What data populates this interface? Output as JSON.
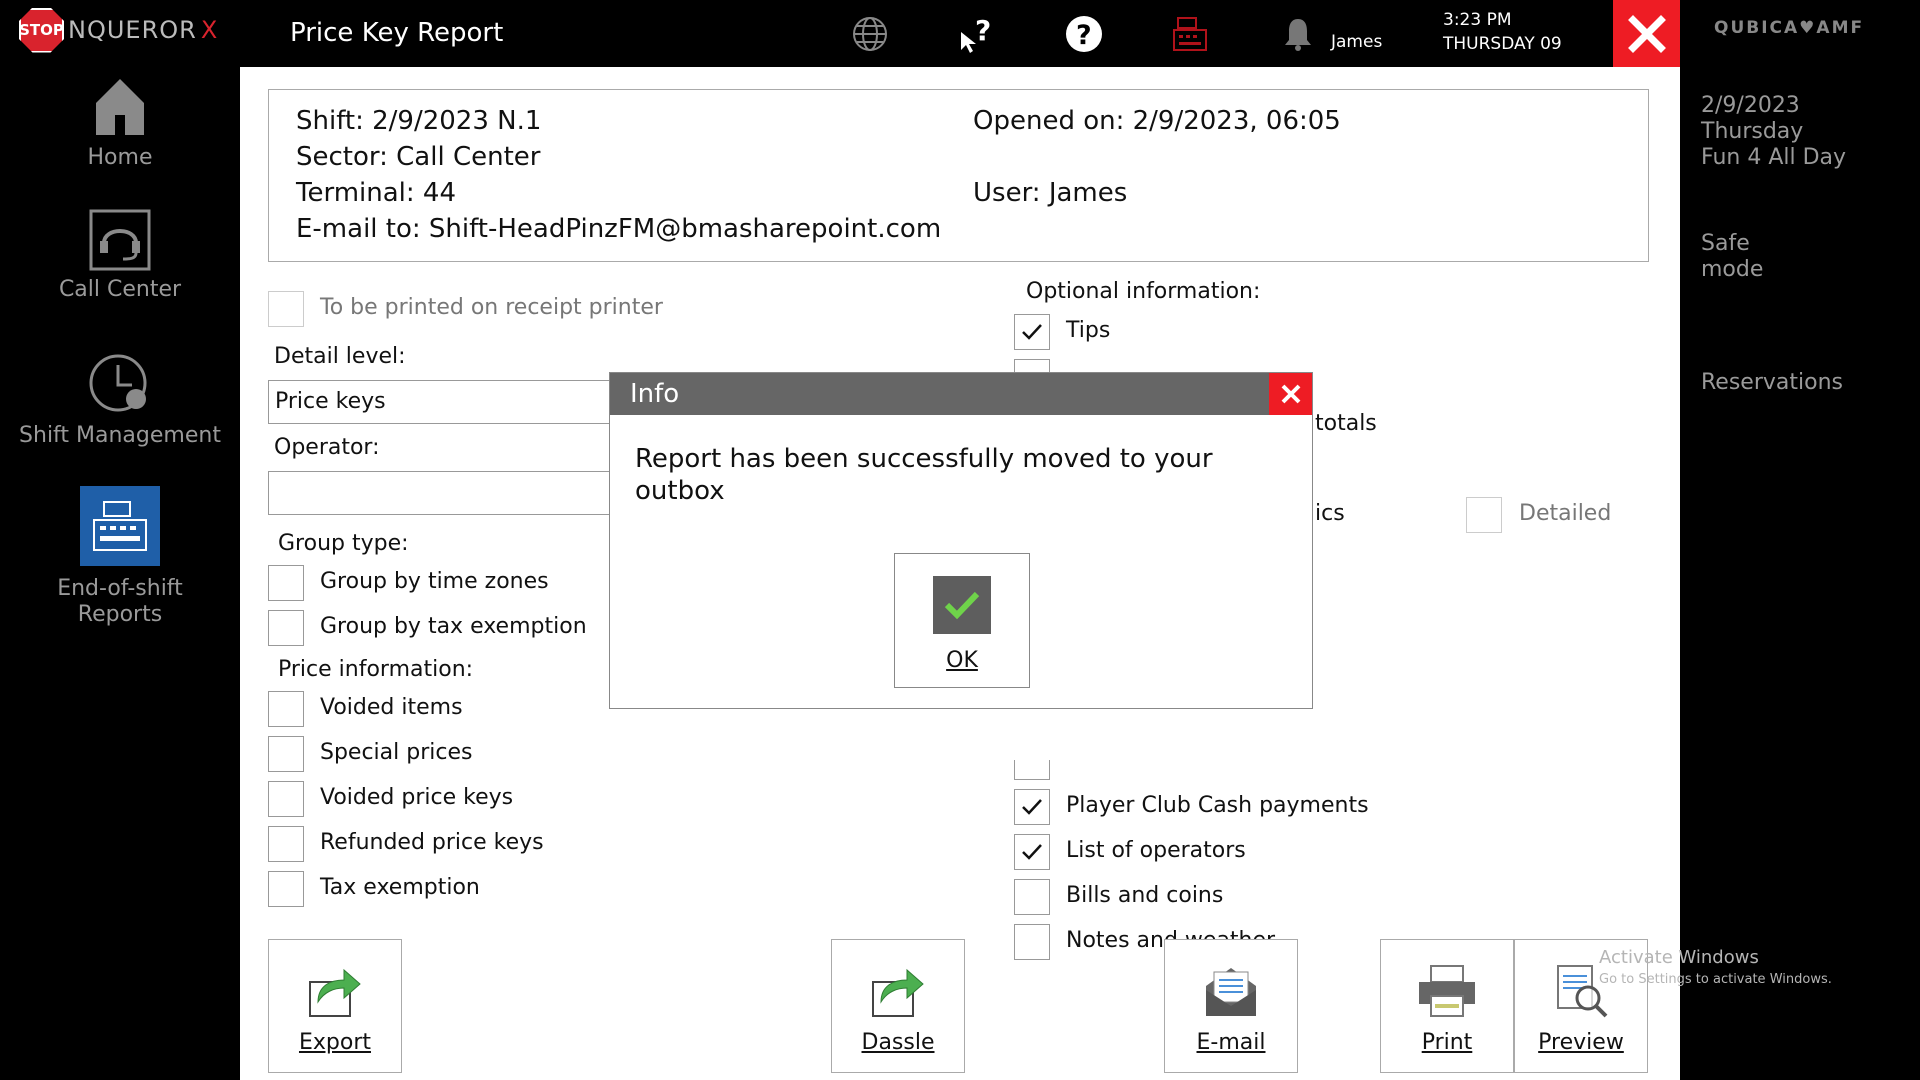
{
  "app": {
    "logo_badge": "STOP",
    "logo_text": "NQUEROR",
    "logo_x": "X",
    "title": "Price Key Report",
    "user": "James",
    "time": "3:23 PM",
    "day": "THURSDAY 09",
    "brand": "QUBICA♥AMF"
  },
  "top_icons": [
    "globe-icon",
    "help-cursor-icon",
    "help-circle-icon",
    "cash-register-icon",
    "bell-icon"
  ],
  "sidebar": {
    "items": [
      {
        "label": "Home",
        "icon": "home-icon"
      },
      {
        "label": "Call Center",
        "icon": "headset-icon"
      },
      {
        "label": "Shift Management",
        "icon": "clock-icon"
      },
      {
        "label_line1": "End-of-shift",
        "label_line2": "Reports",
        "icon": "cash-register-icon",
        "active": true
      }
    ]
  },
  "rightbar": {
    "date": "2/9/2023",
    "weekday": "Thursday",
    "event": "Fun 4 All Day",
    "safe_mode_line1": "Safe",
    "safe_mode_line2": "mode",
    "reservations": "Reservations"
  },
  "shift_info": {
    "shift": "Shift: 2/9/2023 N.1",
    "sector": "Sector: Call Center",
    "terminal": "Terminal: 44",
    "email": "E-mail to: Shift-HeadPinzFM@bmasharepoint.com",
    "opened": "Opened on: 2/9/2023, 06:05",
    "user": "User: James"
  },
  "form": {
    "receipt_printer": "To be printed on receipt printer",
    "detail_level_label": "Detail level:",
    "detail_level_value": "Price keys",
    "operator_label": "Operator:",
    "operator_value": "",
    "group_type_label": "Group type:",
    "group_time_zones": "Group by time zones",
    "group_tax_exemption": "Group by tax exemption",
    "price_info_label": "Price information:",
    "price_items": [
      "Voided items",
      "Special prices",
      "Voided price keys",
      "Refunded price keys",
      "Tax exemption"
    ],
    "optional_label": "Optional information:",
    "optional_tips": "Tips",
    "optional_partial_totals": "totals",
    "optional_partial_ics": "ics",
    "detailed": "Detailed",
    "optional_items_bottom": [
      {
        "label": "Player Club Cash payments",
        "checked": true
      },
      {
        "label": "List of operators",
        "checked": true
      },
      {
        "label": "Bills and coins",
        "checked": false
      },
      {
        "label": "Notes and weather",
        "checked": false
      }
    ]
  },
  "actions": {
    "export": "Export",
    "dassle": "Dassle",
    "email": "E-mail",
    "print": "Print",
    "preview": "Preview"
  },
  "dialog": {
    "title": "Info",
    "message": "Report has been successfully moved to your outbox",
    "ok": "OK"
  },
  "watermark": {
    "line1": "Activate Windows",
    "line2": "Go to Settings to activate Windows."
  },
  "colors": {
    "accent_red": "#ee1c24",
    "active_blue": "#1f5fa8",
    "check_green": "#6fd34a"
  }
}
